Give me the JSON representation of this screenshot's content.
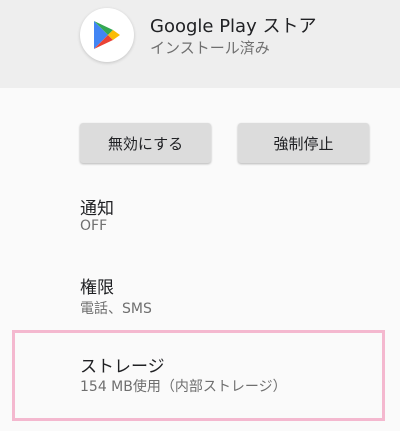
{
  "app": {
    "name": "Google Play ストア",
    "status": "インストール済み",
    "icon": "google-play-icon"
  },
  "actions": {
    "disable_label": "無効にする",
    "force_stop_label": "強制停止"
  },
  "settings": [
    {
      "title": "通知",
      "summary": "OFF"
    },
    {
      "title": "権限",
      "summary": "電話、SMS"
    },
    {
      "title": "ストレージ",
      "summary": "154 MB使用（内部ストレージ）"
    }
  ],
  "colors": {
    "header_background": "#eeeeee",
    "page_background": "#fafafa",
    "button_background": "#dcdcdc",
    "highlight_border": "#f4b8cf"
  }
}
